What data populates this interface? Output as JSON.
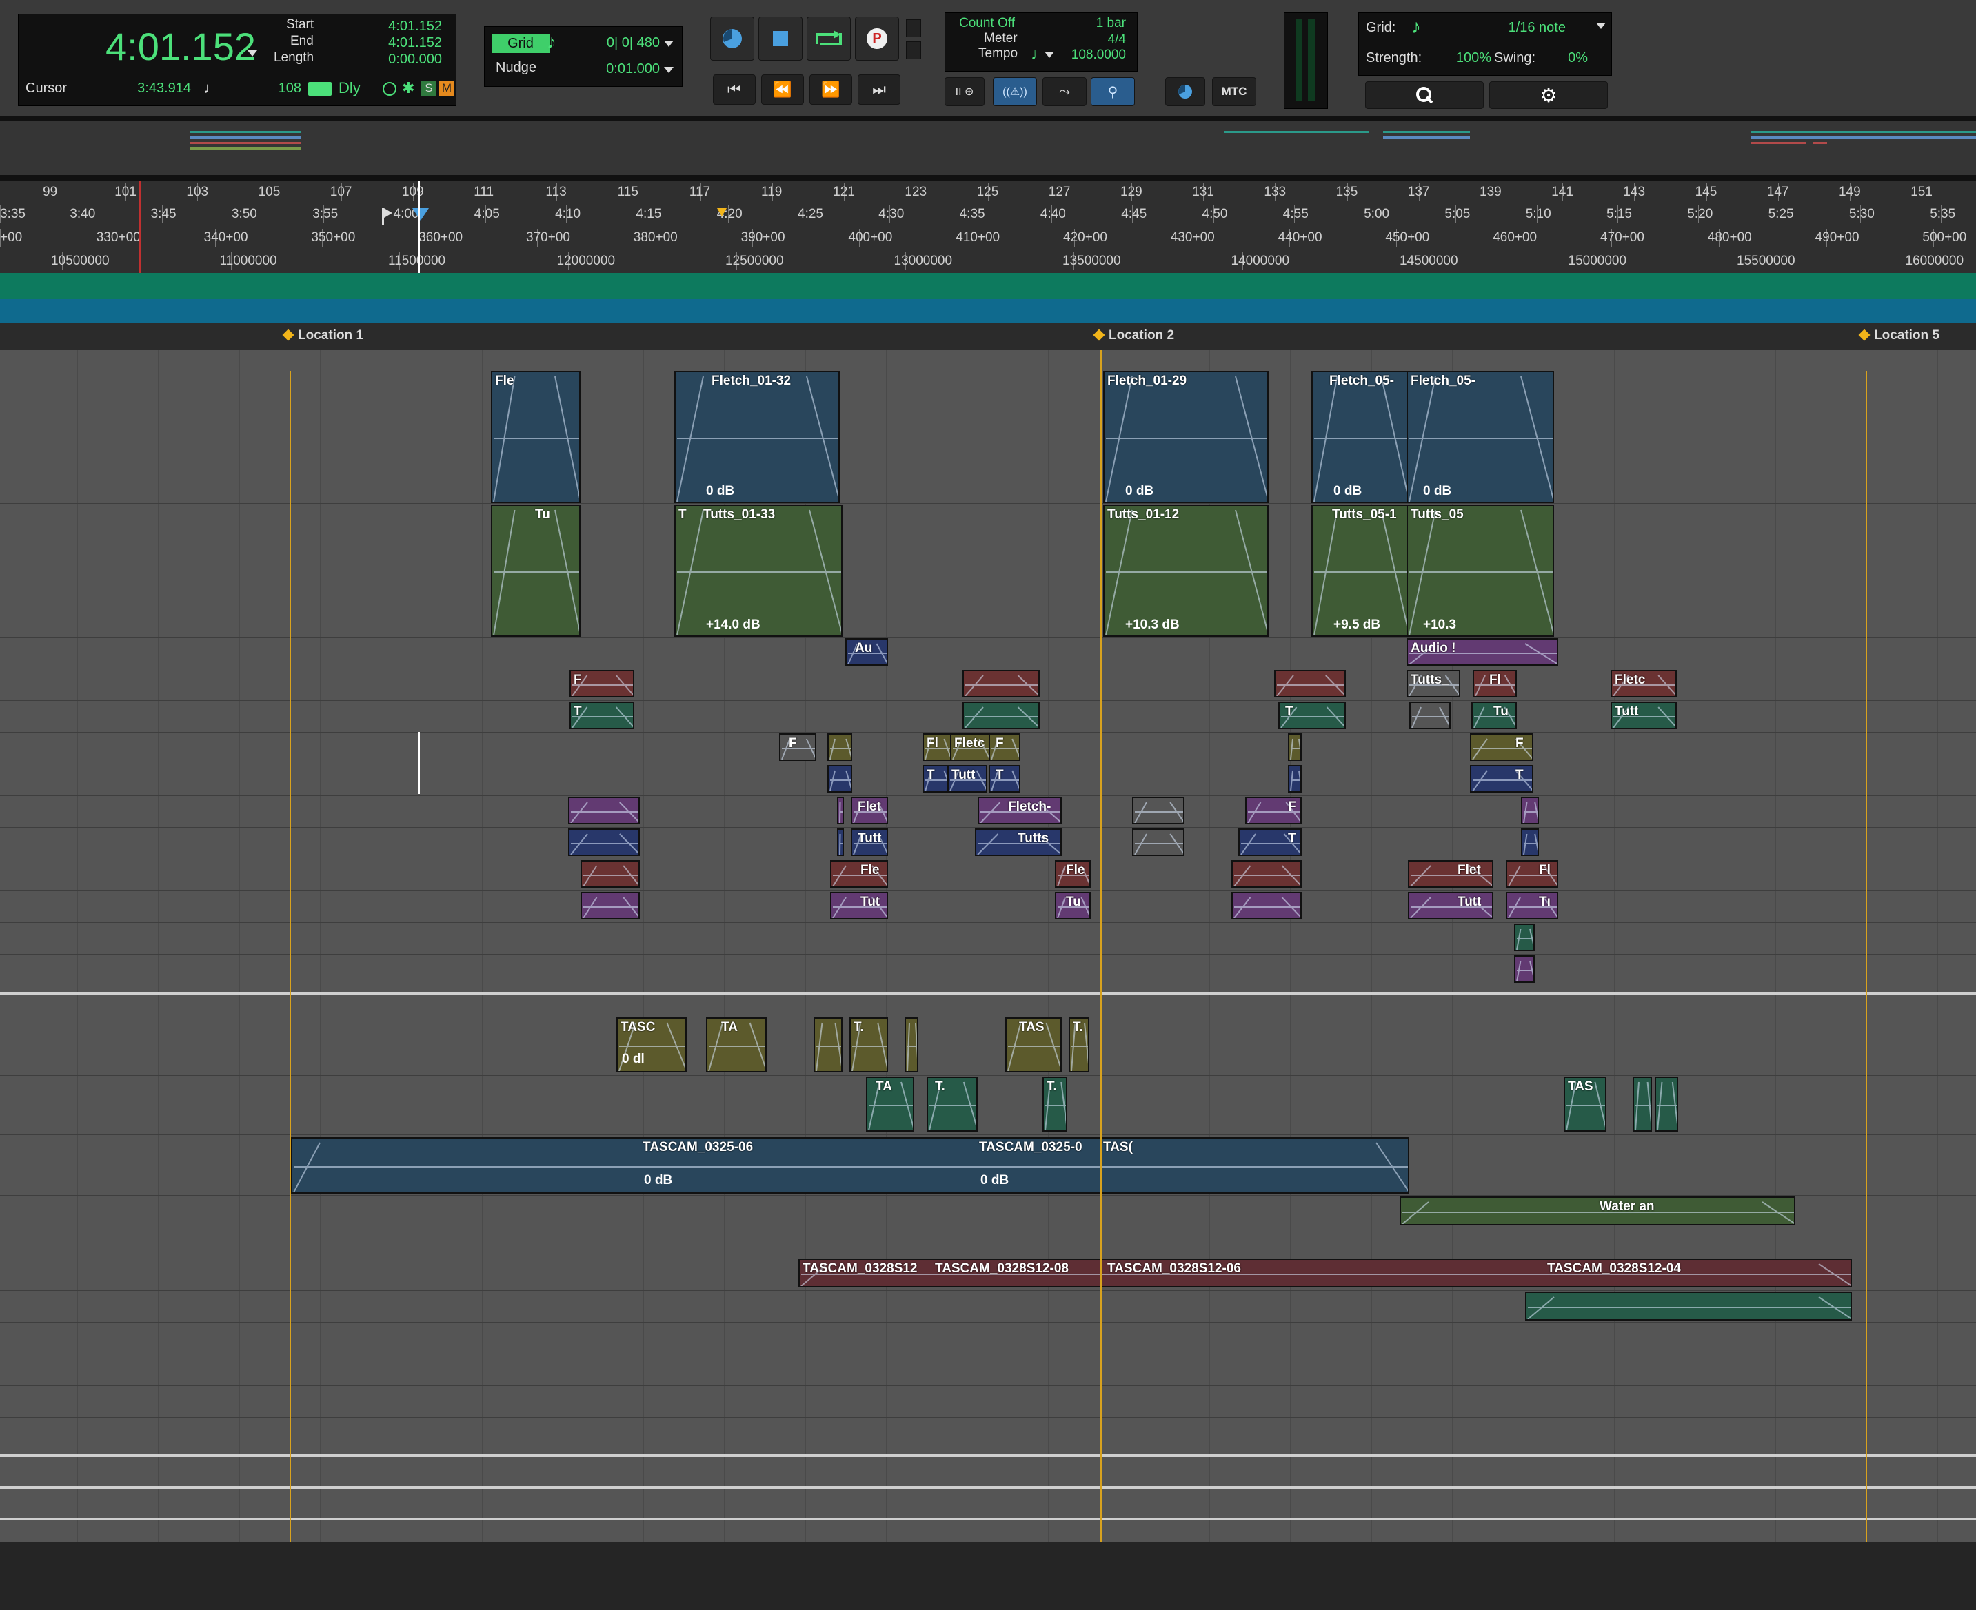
{
  "counter": {
    "main": "4:01.152",
    "start_label": "Start",
    "start": "4:01.152",
    "end_label": "End",
    "end": "4:01.152",
    "length_label": "Length",
    "length": "0:00.000",
    "cursor_label": "Cursor",
    "cursor": "3:43.914",
    "tempo_value": "108",
    "dly": "Dly",
    "s_btn": "S",
    "m_btn": "M"
  },
  "grid_nudge": {
    "grid_label": "Grid",
    "grid_value": "0| 0| 480",
    "nudge_label": "Nudge",
    "nudge_value": "0:01.000"
  },
  "count": {
    "count_off": "Count Off",
    "bars": "1 bar",
    "meter_label": "Meter",
    "meter": "4/4",
    "tempo_label": "Tempo",
    "tempo": "108.0000"
  },
  "mtc": "MTC",
  "quantize": {
    "grid_label": "Grid:",
    "grid_value": "1/16 note",
    "strength_label": "Strength:",
    "strength": "100%",
    "swing_label": "Swing:",
    "swing": "0%"
  },
  "ruler": {
    "bars": [
      "99",
      "101",
      "103",
      "105",
      "107",
      "109",
      "111",
      "113",
      "115",
      "117",
      "119",
      "121",
      "123",
      "125",
      "127",
      "129",
      "131",
      "133",
      "135",
      "137",
      "139",
      "141",
      "143",
      "145",
      "147",
      "149",
      "151"
    ],
    "minsec": [
      "3:35",
      "3:40",
      "3:45",
      "3:50",
      "3:55",
      "4:00",
      "4:05",
      "4:10",
      "4:15",
      "4:20",
      "4:25",
      "4:30",
      "4:35",
      "4:40",
      "4:45",
      "4:50",
      "4:55",
      "5:00",
      "5:05",
      "5:10",
      "5:15",
      "5:20",
      "5:25",
      "5:30",
      "5:35"
    ],
    "timecode": [
      "+00",
      "330+00",
      "340+00",
      "350+00",
      "360+00",
      "370+00",
      "380+00",
      "390+00",
      "400+00",
      "410+00",
      "420+00",
      "430+00",
      "440+00",
      "450+00",
      "460+00",
      "470+00",
      "480+00",
      "490+00",
      "500+00"
    ],
    "samples": [
      "10500000",
      "11000000",
      "11500000",
      "12000000",
      "12500000",
      "13000000",
      "13500000",
      "14000000",
      "14500000",
      "15000000",
      "15500000",
      "16000000"
    ]
  },
  "markers": [
    "Location 1",
    "Location 2",
    "Location 5"
  ],
  "clips": {
    "r1a": "Fle",
    "r1b": "Fletch_01-32",
    "r1c": "Fletch_01-29",
    "r1d": "Fletch_05-",
    "r1e": "Fletch_05-",
    "r1b_db": "0 dB",
    "r1c_db": "0 dB",
    "r1d_db": "0 dB",
    "r1e_db": "0 dB",
    "r2a": "Tu",
    "r2b0": "T",
    "r2b": "Tutts_01-33",
    "r2c": "Tutts_01-12",
    "r2d": "Tutts_05-1",
    "r2e": "Tutts_05",
    "r2b_db": "+14.0 dB",
    "r2c_db": "+10.3 dB",
    "r2d_db": "+9.5 dB",
    "r2e_db": "+10.3",
    "r3a": "Au",
    "r3b": "Audio !",
    "r4a": "F",
    "r4b": "Fl",
    "r4c": "Fletc",
    "r4d": "Tutts_",
    "r5a": "T",
    "r5b": "T",
    "r5c": "Tu",
    "r5d": "Tutt",
    "r6a": "F",
    "r6b": "Fl",
    "r6c": "Fletc",
    "r6d": "F",
    "r6e": "F",
    "r7a": "T",
    "r7b": "Tutt",
    "r7c": "T",
    "r7d": "T",
    "r8a": "Flet",
    "r8b": "Fletch-",
    "r8c": "F",
    "r9a": "Tutt",
    "r9b": "Tutts",
    "r9c": "T",
    "r10a": "Fle",
    "r10b": "Fle",
    "r10c": "Flet",
    "r10d": "Fl",
    "r11a": "Tut",
    "r11b": "Tu",
    "r11c": "Tutt",
    "r11d": "Tı",
    "t1a": "TASC",
    "t1a_db": "0 dl",
    "t1b": "TA",
    "t1c": "T.",
    "t1d": "TAS",
    "t1e": "T.",
    "t2a": "TA",
    "t2b": "T.",
    "t2c": "T.",
    "t2d": "TAS",
    "t3a": "TASCAM_0325-06",
    "t3a_db": "0 dB",
    "t3b": "TASCAM_0325-0",
    "t3b_db": "0 dB",
    "t3c": "TAS(",
    "t4a": "Water an",
    "t5a": "TASCAM_0328S12",
    "t5b": "TASCAM_0328S12-08",
    "t5c": "TASCAM_0328S12-06",
    "t5d": "TASCAM_0328S12-04"
  }
}
